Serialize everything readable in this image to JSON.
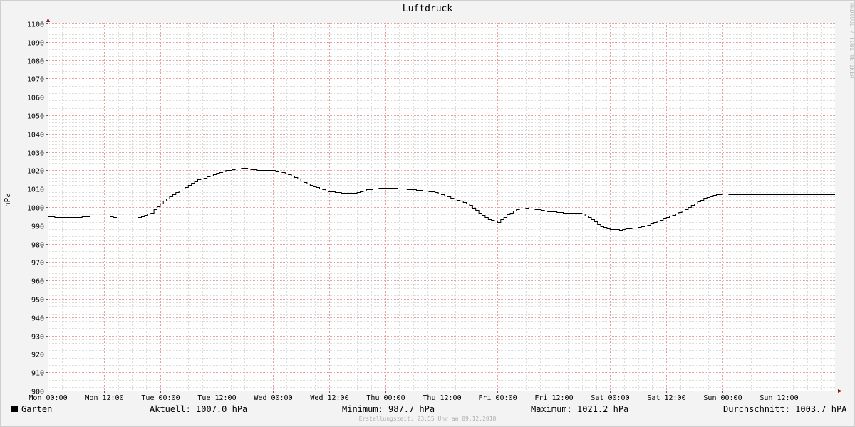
{
  "chart_data": {
    "type": "line",
    "title": "Luftdruck",
    "ylabel": "hPa",
    "xlabel": "",
    "ylim": [
      900,
      1100
    ],
    "y_ticks": [
      900,
      910,
      920,
      930,
      940,
      950,
      960,
      970,
      980,
      990,
      1000,
      1010,
      1020,
      1030,
      1040,
      1050,
      1060,
      1070,
      1080,
      1090,
      1100
    ],
    "x_tick_labels": [
      "Mon 00:00",
      "Mon 12:00",
      "Tue 00:00",
      "Tue 12:00",
      "Wed 00:00",
      "Wed 12:00",
      "Thu 00:00",
      "Thu 12:00",
      "Fri 00:00",
      "Fri 12:00",
      "Sat 00:00",
      "Sat 12:00",
      "Sun 00:00",
      "Sun 12:00"
    ],
    "xlim_hours": [
      0,
      168
    ],
    "grid": true,
    "legend_position": "bottom-left",
    "series": [
      {
        "name": "Garten",
        "color": "#000000",
        "x_hours": [
          0,
          3,
          6,
          8,
          9,
          12,
          14,
          16,
          18,
          20,
          22,
          24,
          26,
          28,
          30,
          32,
          34,
          36,
          38,
          40,
          42,
          44,
          46,
          48,
          50,
          52,
          54,
          56,
          58,
          60,
          62,
          64,
          66,
          68,
          70,
          72,
          74,
          76,
          78,
          80,
          82,
          84,
          86,
          88,
          90,
          92,
          94,
          96,
          98,
          100,
          102,
          104,
          106,
          108,
          110,
          112,
          113,
          114,
          116,
          118,
          120,
          122,
          124,
          126,
          128,
          130,
          132,
          134,
          136,
          138,
          140,
          142,
          144,
          146,
          148,
          150,
          152,
          154,
          156,
          158,
          160,
          162,
          164,
          166,
          168
        ],
        "values": [
          995,
          994.5,
          994.5,
          995,
          995.5,
          995.5,
          994.5,
          994,
          994,
          995,
          997,
          1002,
          1006,
          1009,
          1012,
          1015,
          1016.5,
          1018.5,
          1020,
          1021,
          1021.2,
          1020.5,
          1020,
          1020,
          1019,
          1017,
          1014.5,
          1012,
          1010,
          1008.5,
          1008,
          1007.8,
          1008,
          1009.5,
          1010.2,
          1010.5,
          1010.3,
          1010,
          1009.5,
          1009,
          1008.5,
          1007,
          1005,
          1003.5,
          1001,
          997,
          993.5,
          992,
          996,
          999,
          999.5,
          999,
          998,
          997.5,
          997,
          997,
          997,
          996.5,
          993.5,
          989.5,
          988,
          987.7,
          988.5,
          989,
          990.5,
          992.5,
          994.5,
          996.5,
          999,
          1002,
          1005,
          1006.5,
          1007.5,
          1007,
          1007,
          1007,
          1007,
          1007,
          1007,
          1007,
          1007,
          1007,
          1007,
          1007,
          1007
        ],
        "visible_until_hours": 168
      }
    ]
  },
  "legend": {
    "series_name": "Garten",
    "current_label": "Aktuell:",
    "current_value": "1007.0 hPa",
    "min_label": "Minimum:",
    "min_value": "987.7 hPa",
    "max_label": "Maximum:",
    "max_value": "1021.2 hPa",
    "avg_label": "Durchschnitt:",
    "avg_value": "1003.7 hPA"
  },
  "watermark": "RRDTOOL / TOBI OETIKER",
  "footer": "Erstellungszeit: 23:55 Uhr am 09.12.2018",
  "colors": {
    "background": "#f3f3f3",
    "plot_background": "#ffffff",
    "major_grid": "#e8a0a0",
    "minor_grid": "#dcdcdc",
    "axis": "#5a5a5a",
    "arrow": "#8b1a1a",
    "line": "#000000"
  }
}
